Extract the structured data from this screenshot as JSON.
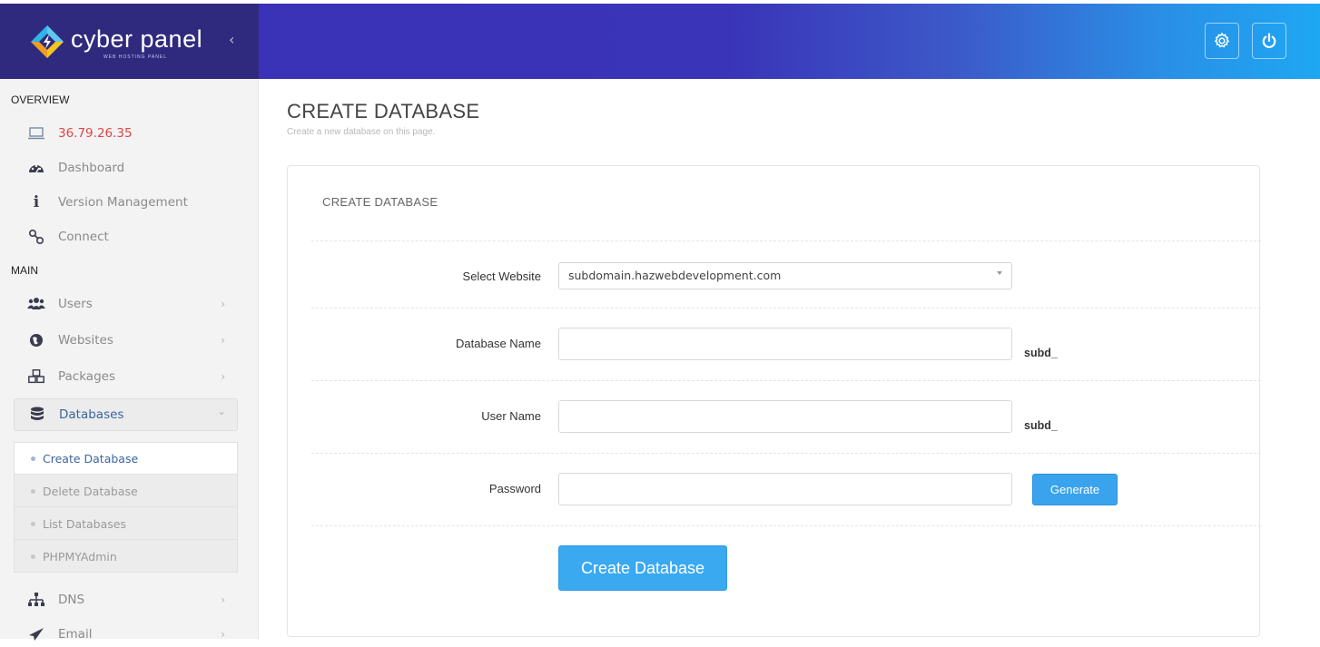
{
  "header": {
    "brand_name": "cyber panel",
    "brand_tagline": "WEB HOSTING PANEL",
    "collapse_glyph": "‹",
    "settings_icon": "gear-icon",
    "power_icon": "power-icon",
    "colors": {
      "gradient_start": "#3b30b6",
      "gradient_end": "#1ea7f3",
      "brand_bg": "#302a7e"
    }
  },
  "sidebar": {
    "overview_title": "OVERVIEW",
    "main_title": "MAIN",
    "overview_items": [
      {
        "label": "36.79.26.35",
        "icon": "laptop-icon"
      },
      {
        "label": "Dashboard",
        "icon": "dashboard-icon"
      },
      {
        "label": "Version Management",
        "icon": "info-icon"
      },
      {
        "label": "Connect",
        "icon": "link-icon"
      }
    ],
    "main_items": [
      {
        "label": "Users",
        "icon": "users-icon"
      },
      {
        "label": "Websites",
        "icon": "globe-icon"
      },
      {
        "label": "Packages",
        "icon": "cubes-icon"
      },
      {
        "label": "Databases",
        "icon": "database-icon"
      },
      {
        "label": "DNS",
        "icon": "sitemap-icon"
      },
      {
        "label": "Email",
        "icon": "paper-plane-icon"
      }
    ],
    "database_submenu": [
      {
        "label": "Create Database"
      },
      {
        "label": "Delete Database"
      },
      {
        "label": "List Databases"
      },
      {
        "label": "PHPMYAdmin"
      }
    ],
    "chevron_right": "›",
    "chevron_down": "⌄"
  },
  "main": {
    "page_title": "CREATE DATABASE",
    "page_subtitle": "Create a new database on this page.",
    "panel_title": "CREATE DATABASE",
    "form": {
      "website_label": "Select Website",
      "website_value": "subdomain.hazwebdevelopment.com",
      "dbname_label": "Database Name",
      "dbname_value": "",
      "dbname_suffix": "subd_",
      "username_label": "User Name",
      "username_value": "",
      "username_suffix": "subd_",
      "password_label": "Password",
      "password_value": "",
      "generate_label": "Generate",
      "submit_label": "Create Database"
    },
    "colors": {
      "primary_button": "#3aa9f0",
      "ip_text": "#e04444",
      "active_link": "#3a65a0"
    }
  }
}
